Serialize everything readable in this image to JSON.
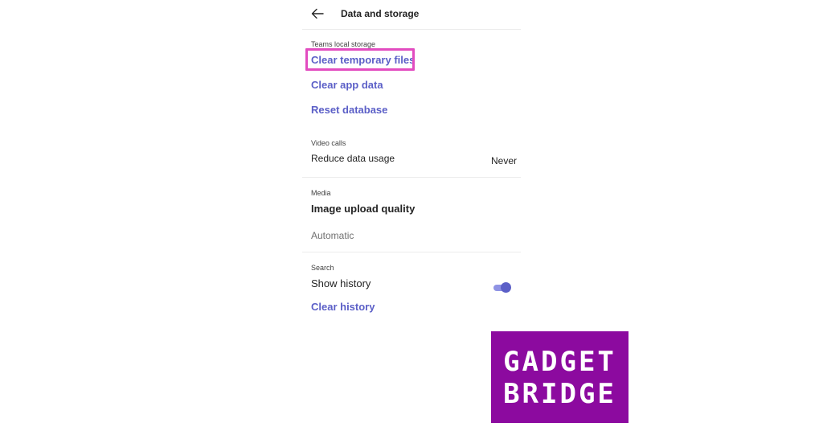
{
  "header": {
    "title": "Data and storage"
  },
  "local_storage": {
    "label": "Teams local storage",
    "clear_temporary_files": "Clear temporary files",
    "clear_app_data": "Clear app data",
    "reset_database": "Reset database"
  },
  "video_calls": {
    "label": "Video calls",
    "reduce_data_usage": "Reduce data usage",
    "reduce_data_usage_value": "Never"
  },
  "media": {
    "label": "Media",
    "image_upload_quality": "Image upload quality",
    "image_upload_quality_value": "Automatic"
  },
  "search": {
    "label": "Search",
    "show_history": "Show history",
    "show_history_enabled": true,
    "clear_history": "Clear history"
  },
  "watermark": {
    "line1": "GADGET",
    "line2": "BRIDGE",
    "background_color": "#8c0a9f"
  },
  "colors": {
    "accent": "#5b5fc7",
    "highlight": "#e24cc0"
  }
}
